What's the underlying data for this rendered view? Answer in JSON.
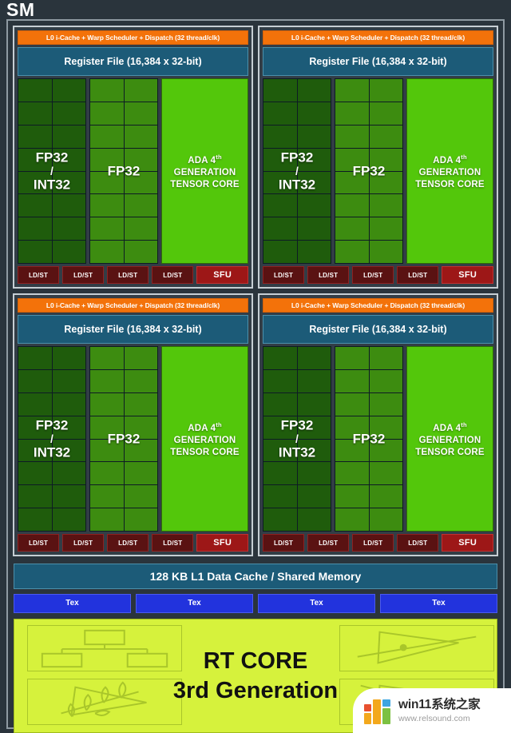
{
  "diagram": {
    "title": "SM",
    "colors": {
      "background": "#2a343c",
      "scheduler_orange": "#f3720a",
      "register_file_blue": "#1c5b78",
      "fp32_int32_green": "#1f5c0c",
      "fp32_green": "#3d8c10",
      "tensor_core_green": "#53c70b",
      "ldst_dark_red": "#5a1212",
      "sfu_red": "#9d1717",
      "tex_blue": "#2233dd",
      "rt_core_yellow": "#d6f23c",
      "frame_border": "#8f9aa2"
    }
  },
  "processing_block": {
    "scheduler_label": "L0 i-Cache + Warp Scheduler + Dispatch (32 thread/clk)",
    "register_file_label": "Register File (16,384 x 32-bit)",
    "fp32_int32_label_line1": "FP32",
    "fp32_int32_label_slash": "/",
    "fp32_int32_label_line2": "INT32",
    "fp32_label": "FP32",
    "tensor_core_line1_a": "ADA 4",
    "tensor_core_line1_sup": "th",
    "tensor_core_line2": "GENERATION",
    "tensor_core_line3": "TENSOR CORE",
    "ldst_label": "LD/ST",
    "sfu_label": "SFU",
    "ldst_count": 4,
    "core_rows": 8,
    "core_cols": 2
  },
  "processing_blocks": [
    {
      "id": "pb-0"
    },
    {
      "id": "pb-1"
    },
    {
      "id": "pb-2"
    },
    {
      "id": "pb-3"
    }
  ],
  "l1_cache": {
    "label": "128 KB L1 Data Cache / Shared Memory"
  },
  "tex_units": {
    "labels": [
      "Tex",
      "Tex",
      "Tex",
      "Tex"
    ]
  },
  "rt_core": {
    "title_line1": "RT CORE",
    "title_line2": "3rd Generation",
    "icons": [
      {
        "name": "bvh-tree-icon",
        "position": "top-left"
      },
      {
        "name": "alpha-test-triangle-icon",
        "position": "bottom-left"
      },
      {
        "name": "ray-triangle-intersect-icon",
        "position": "top-right"
      },
      {
        "name": "ray-triangle-miss-icon",
        "position": "bottom-right"
      }
    ]
  },
  "watermark": {
    "name": "win11系统之家",
    "url": "www.relsound.com"
  }
}
